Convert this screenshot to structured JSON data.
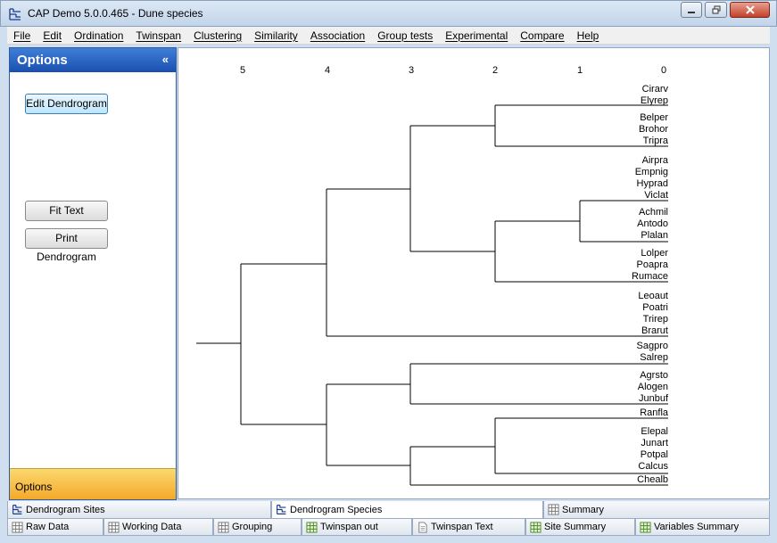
{
  "window": {
    "title": "CAP Demo 5.0.0.465 - Dune species"
  },
  "menu": [
    "File",
    "Edit",
    "Ordination",
    "Twinspan",
    "Clustering",
    "Similarity",
    "Association",
    "Group tests",
    "Experimental",
    "Compare",
    "Help"
  ],
  "options_panel": {
    "header": "Options",
    "buttons": {
      "edit": "Edit Dendrogram",
      "fit": "Fit Text",
      "print": "Print Dendrogram"
    },
    "footer": "Options"
  },
  "dendrogram": {
    "scale_ticks": [
      "5",
      "4",
      "3",
      "2",
      "1",
      "0"
    ],
    "leaves": [
      "Cirarv",
      "Elyrep",
      "Belper",
      "Brohor",
      "Tripra",
      "Airpra",
      "Empnig",
      "Hyprad",
      "Viclat",
      "Achmil",
      "Antodo",
      "Plalan",
      "Lolper",
      "Poapra",
      "Rumace",
      "Leoaut",
      "Poatri",
      "Trirep",
      "Brarut",
      "Sagpro",
      "Salrep",
      "Agrsto",
      "Alogen",
      "Junbuf",
      "Ranfla",
      "Elepal",
      "Junart",
      "Potpal",
      "Calcus",
      "Chealb"
    ]
  },
  "tabs_row1": [
    {
      "label": "Dendrogram Sites",
      "icon": "dendrogram-icon"
    },
    {
      "label": "Dendrogram Species",
      "icon": "dendrogram-icon",
      "selected": true
    },
    {
      "label": "Summary",
      "icon": "grid-icon"
    }
  ],
  "tabs_row2": [
    {
      "label": "Raw Data",
      "icon": "grid-icon"
    },
    {
      "label": "Working Data",
      "icon": "grid-icon"
    },
    {
      "label": "Grouping",
      "icon": "grid-icon"
    },
    {
      "label": "Twinspan out",
      "icon": "green-grid-icon"
    },
    {
      "label": "Twinspan Text",
      "icon": "document-icon"
    },
    {
      "label": "Site Summary",
      "icon": "green-grid-icon"
    },
    {
      "label": "Variables Summary",
      "icon": "green-grid-icon"
    }
  ]
}
